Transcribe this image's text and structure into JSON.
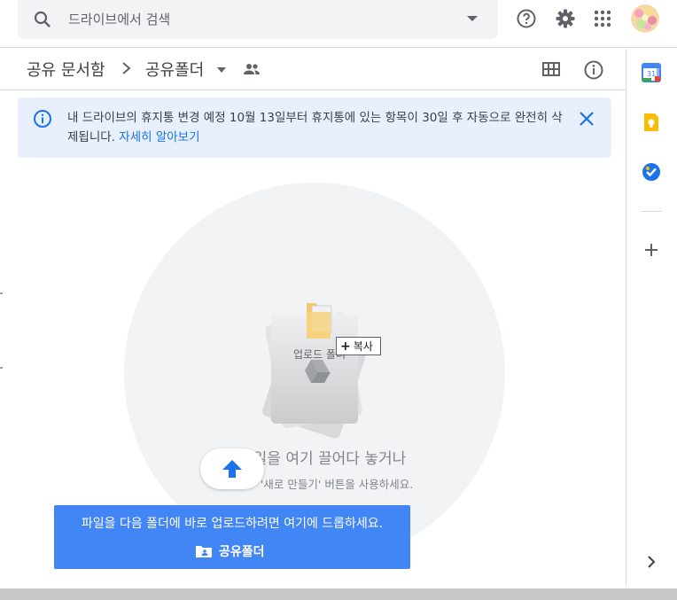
{
  "search": {
    "placeholder": "드라이브에서 검색"
  },
  "header": {
    "icons": [
      "help-icon",
      "settings-icon",
      "apps-icon",
      "avatar"
    ]
  },
  "breadcrumb": {
    "root": "공유 문서함",
    "current": "공유폴더"
  },
  "banner": {
    "text": "내 드라이브의 휴지통 변경 예정 10월 13일부터 휴지통에 있는 항목이 30일 후 자동으로 완전히 삭제됩니다.",
    "link": "자세히 알아보기"
  },
  "dropzone": {
    "title": "파일을 여기 끌어다 놓거나",
    "subtitle": "'새로 만들기' 버튼을 사용하세요.",
    "drag_item_name": "업로드 폴더",
    "copy_badge": "복사"
  },
  "toast": {
    "message": "파일을 다음 폴더에 바로 업로드하려면 여기에 드롭하세요.",
    "folder": "공유폴더"
  },
  "rail": {
    "items": [
      "calendar-icon",
      "keep-icon",
      "tasks-icon",
      "add-icon",
      "expand-icon"
    ]
  },
  "colors": {
    "accent": "#1a73e8",
    "toast": "#4285f4",
    "banner": "#e8f0fe"
  }
}
